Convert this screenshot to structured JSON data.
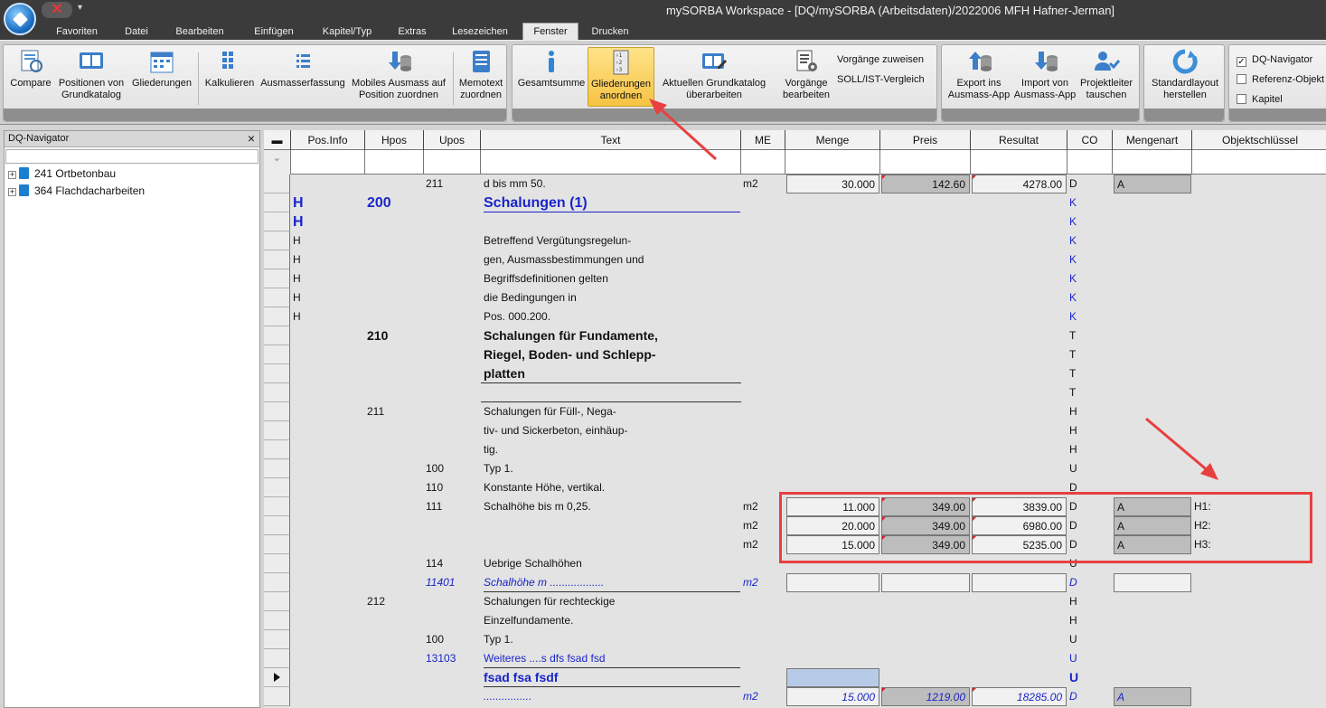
{
  "window_title": "mySORBA Workspace - [DQ/mySORBA (Arbeitsdaten)/2022006 MFH Hafner-Jerman]",
  "tabs": [
    "Favoriten",
    "Datei",
    "Bearbeiten",
    "Einfügen",
    "Kapitel/Typ",
    "Extras",
    "Lesezeichen",
    "Fenster",
    "Drucken"
  ],
  "active_tab": "Fenster",
  "ribbon": {
    "compare": "Compare",
    "positionen": "Positionen von Grundkatalog",
    "gliederungen": "Gliederungen",
    "kalkulieren": "Kalkulieren",
    "ausmasserfassung": "Ausmasserfassung",
    "mobiles": "Mobiles Ausmass auf Position zuordnen",
    "memotext": "Memotext zuordnen",
    "gesamtsumme": "Gesamtsumme",
    "gliederungen_anordnen": "Gliederungen anordnen",
    "aktuellen": "Aktuellen Grundkatalog überarbeiten",
    "vorgaenge_bearbeiten": "Vorgänge bearbeiten",
    "vorgaenge_zuweisen": "Vorgänge zuweisen",
    "soll_ist": "SOLL/IST-Vergleich",
    "export": "Export ins Ausmass-App",
    "import": "Import von Ausmass-App",
    "projektleiter": "Projektleiter tauschen",
    "standardlayout": "Standardlayout herstellen",
    "dq_navigator": "DQ-Navigator",
    "referenz": "Referenz-Objekt",
    "kapitel": "Kapitel"
  },
  "navigator": {
    "title": "DQ-Navigator",
    "items": [
      {
        "label": "241 Ortbetonbau"
      },
      {
        "label": "364 Flachdacharbeiten"
      }
    ]
  },
  "grid": {
    "headers": [
      "Pos.Info",
      "Hpos",
      "Upos",
      "Text",
      "ME",
      "Menge",
      "Preis",
      "Resultat",
      "CO",
      "Mengenart",
      "Objektschlüssel"
    ],
    "rows": [
      {
        "upos": "211",
        "text": "d bis mm 50.",
        "me": "m2",
        "menge": "30.000",
        "preis": "142.60",
        "resultat": "4278.00",
        "co": "D",
        "mengenart": "A"
      },
      {
        "info": "H",
        "hpos": "200",
        "text": "Schalungen (1)",
        "co": "K"
      },
      {
        "info": "H",
        "co": "K"
      },
      {
        "info": "H",
        "text": "Betreffend Vergütungsregelun-",
        "co": "K"
      },
      {
        "info": "H",
        "text": "gen, Ausmassbestimmungen und",
        "co": "K"
      },
      {
        "info": "H",
        "text": "Begriffsdefinitionen gelten",
        "co": "K"
      },
      {
        "info": "H",
        "text": "die Bedingungen in",
        "co": "K"
      },
      {
        "info": "H",
        "text": "Pos. 000.200.",
        "co": "K"
      },
      {
        "hpos": "210",
        "text": "Schalungen für Fundamente,",
        "co": "T"
      },
      {
        "text": "Riegel, Boden- und Schlepp-",
        "co": "T"
      },
      {
        "text": "platten",
        "co": "T"
      },
      {
        "co": "T"
      },
      {
        "hpos": "211",
        "text": "Schalungen für Füll-, Nega-",
        "co": "H"
      },
      {
        "text": "tiv- und Sickerbeton, einhäup-",
        "co": "H"
      },
      {
        "text": "tig.",
        "co": "H"
      },
      {
        "upos": "100",
        "text": "Typ 1.",
        "co": "U"
      },
      {
        "upos": "110",
        "text": "Konstante Höhe, vertikal.",
        "co": "D"
      },
      {
        "upos": "111",
        "text": "Schalhöhe bis m 0,25.",
        "me": "m2",
        "menge": "11.000",
        "preis": "349.00",
        "resultat": "3839.00",
        "co": "D",
        "mengenart": "A",
        "obj": "H1:"
      },
      {
        "me": "m2",
        "menge": "20.000",
        "preis": "349.00",
        "resultat": "6980.00",
        "co": "D",
        "mengenart": "A",
        "obj": "H2:"
      },
      {
        "me": "m2",
        "menge": "15.000",
        "preis": "349.00",
        "resultat": "5235.00",
        "co": "D",
        "mengenart": "A",
        "obj": "H3:"
      },
      {
        "upos": "114",
        "text": "Uebrige Schalhöhen",
        "co": "U"
      },
      {
        "upos": "11401",
        "text": "Schalhöhe m ..................",
        "me": "m2",
        "co": "D"
      },
      {
        "hpos": "212",
        "text": "Schalungen für rechteckige",
        "co": "H"
      },
      {
        "text": "Einzelfundamente.",
        "co": "H"
      },
      {
        "upos": "100",
        "text": "Typ 1.",
        "co": "U"
      },
      {
        "upos": "13103",
        "text": "Weiteres ....s dfs fsad fsd",
        "co": "U"
      },
      {
        "text": "fsad fsa fsdf",
        "co": "U"
      },
      {
        "text": "................",
        "me": "m2",
        "menge": "15.000",
        "preis": "1219.00",
        "resultat": "18285.00",
        "co": "D",
        "mengenart": "A"
      }
    ]
  }
}
